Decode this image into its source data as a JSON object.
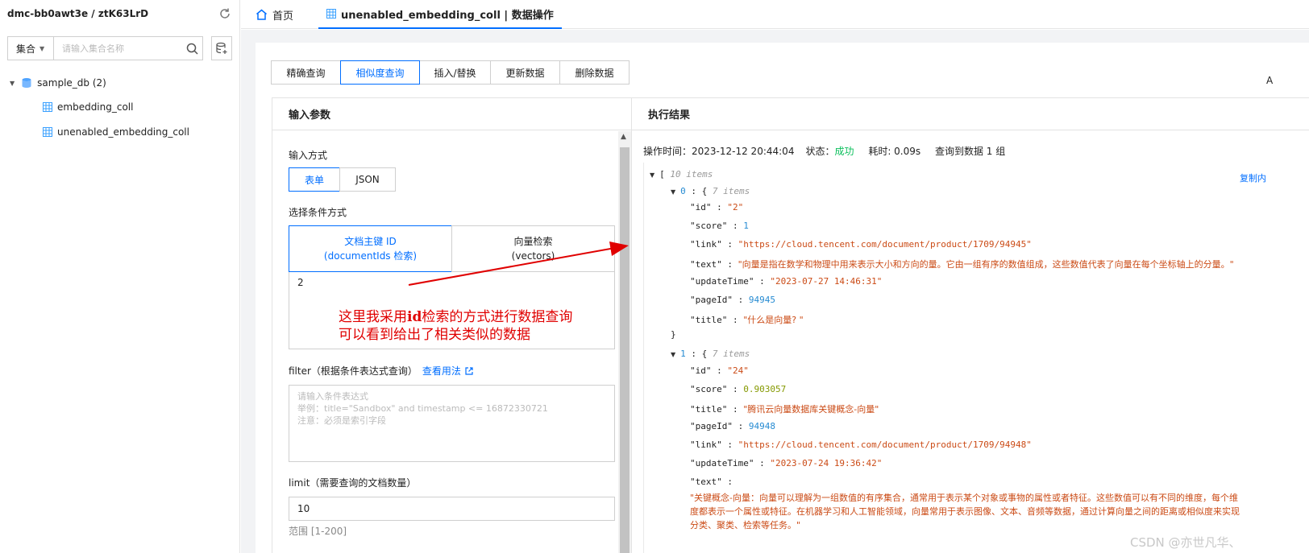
{
  "sidebar": {
    "title": "dmc-bb0awt3e / ztK63LrD",
    "select_label": "集合",
    "search_placeholder": "请输入集合名称",
    "tree": {
      "db": "sample_db (2)",
      "collections": [
        "embedding_coll",
        "unenabled_embedding_coll"
      ]
    }
  },
  "top_tabs": {
    "home": "首页",
    "active": "unenabled_embedding_coll | 数据操作"
  },
  "op_tabs": [
    "精确查询",
    "相似度查询",
    "插入/替换",
    "更新数据",
    "删除数据"
  ],
  "op_tab_active_index": 1,
  "right_edge_letter": "A",
  "input": {
    "title": "输入参数",
    "mode_label": "输入方式",
    "modes": [
      "表单",
      "JSON"
    ],
    "cond_label": "选择条件方式",
    "cond_id_line1": "文档主键 ID",
    "cond_id_line2": "(documentIds 检索)",
    "cond_vec_line1": "向量检索",
    "cond_vec_line2": "(vectors)",
    "id_value": "2",
    "filter_label": "filter（根据条件表达式查询）",
    "filter_link": "查看用法",
    "filter_ph1": "请输入条件表达式",
    "filter_ph2": "举例：title=\"Sandbox\" and timestamp <= 16872330721",
    "filter_ph3": "注意：必须是索引字段",
    "limit_label": "limit（需要查询的文档数量）",
    "limit_value": "10",
    "limit_range": "范围 [1-200]"
  },
  "result": {
    "title": "执行结果",
    "op_time": "操作时间：2023-12-12 20:44:04",
    "status_label": "状态：",
    "status_value": "成功",
    "elapsed": "耗时: 0.09s",
    "count": "查询到数据 1 组",
    "copy_link": "复制内",
    "json": {
      "root": "[",
      "root_count": "10 items",
      "obj0_count": "7 items",
      "obj1_count": "7 items",
      "i0": {
        "id": "\"2\"",
        "score": "1",
        "link": "\"https://cloud.tencent.com/document/product/1709/94945\"",
        "text": "\"向量是指在数学和物理中用来表示大小和方向的量。它由一组有序的数值组成，这些数值代表了向量在每个坐标轴上的分量。\"",
        "updateTime": "\"2023-07-27 14:46:31\"",
        "pageId": "94945",
        "title": "\"什么是向量? \""
      },
      "i1": {
        "id": "\"24\"",
        "score": "0.903057",
        "title": "\"腾讯云向量数据库关键概念-向量\"",
        "pageId": "94948",
        "link": "\"https://cloud.tencent.com/document/product/1709/94948\"",
        "updateTime": "\"2023-07-24 19:36:42\"",
        "text_l1": "\"关键概念-向量：向量可以理解为一组数值的有序集合，通常用于表示某个对象或事物的属性或者特征。这些数值可以有不同的维度，每个维",
        "text_l2": "度都表示一个属性或特征。在机器学习和人工智能领域，向量常用于表示图像、文本、音频等数据，通过计算向量之间的距离或相似度来实现",
        "text_l3": "分类、聚类、检索等任务。\""
      }
    }
  },
  "annotation": {
    "line1_a": "这里我采用",
    "line1_b": "id",
    "line1_c": "检索的方式进行数据查询",
    "line2": "可以看到给出了相关类似的数据",
    "color": "#e00000"
  },
  "watermark": "CSDN @亦世凡华、",
  "colors": {
    "accent": "#006eff",
    "success": "#0abf5b",
    "json_string": "#cb4b16",
    "json_number": "#268bd2",
    "json_float": "#859900"
  }
}
